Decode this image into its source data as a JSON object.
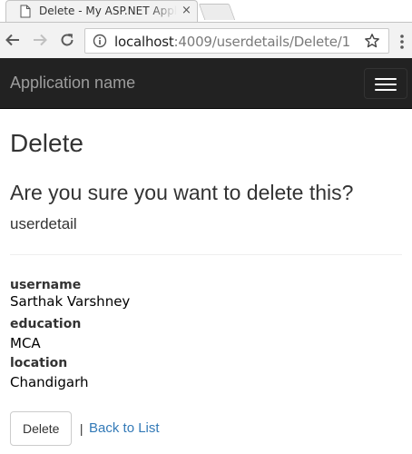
{
  "browser": {
    "tab_title": "Delete - My ASP.NET Application",
    "tab_close": "×",
    "url_host": "localhost",
    "url_rest": ":4009/userdetails/Delete/1",
    "icons": [
      "page-icon",
      "back-arrow-icon",
      "forward-arrow-icon",
      "reload-icon",
      "info-icon",
      "star-icon",
      "kebab-menu-icon"
    ]
  },
  "navbar": {
    "brand": "Application name",
    "background": "#222222",
    "brand_color": "#9d9d9d"
  },
  "page": {
    "title": "Delete",
    "question": "Are you sure you want to delete this?",
    "entity": "userdetail"
  },
  "details": {
    "username_label": "username",
    "username_value": "Sarthak Varshney",
    "education_label": "education",
    "education_value": "MCA",
    "location_label": "location",
    "location_value": "Chandigarh"
  },
  "actions": {
    "delete_label": "Delete",
    "separator": "|",
    "back_label": "Back to List",
    "link_color": "#337ab7"
  }
}
